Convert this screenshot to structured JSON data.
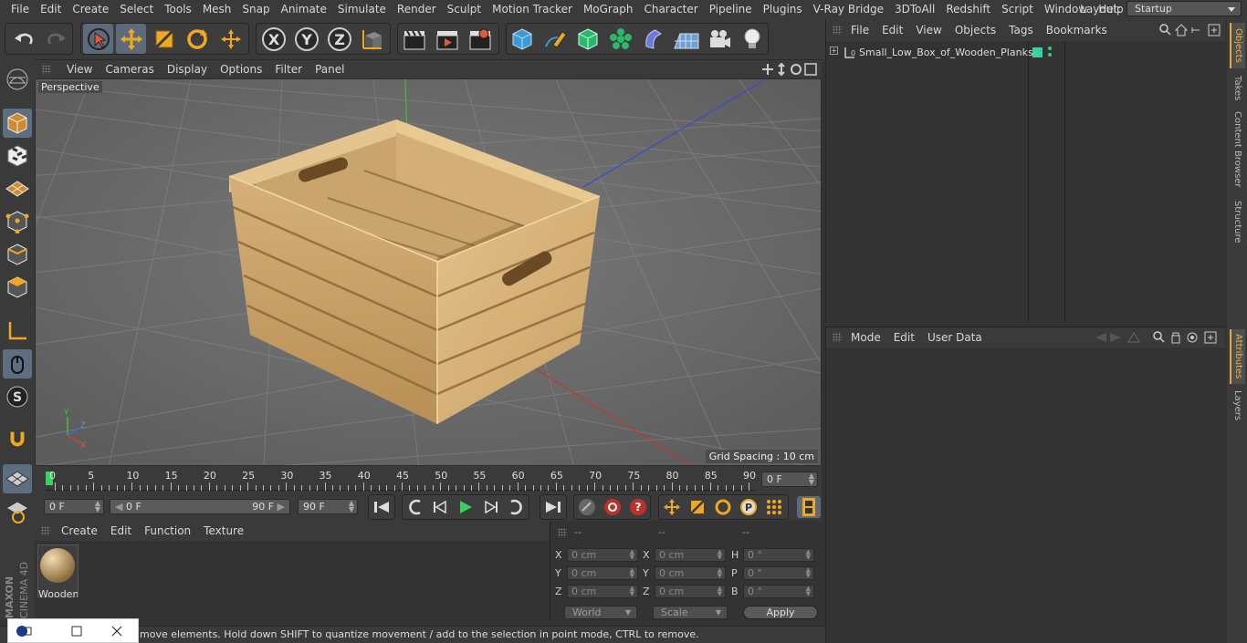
{
  "menubar": {
    "items": [
      "File",
      "Edit",
      "Create",
      "Select",
      "Tools",
      "Mesh",
      "Snap",
      "Animate",
      "Simulate",
      "Render",
      "Sculpt",
      "Motion Tracker",
      "MoGraph",
      "Character",
      "Pipeline",
      "Plugins",
      "V-Ray Bridge",
      "3DToAll",
      "Redshift",
      "Script",
      "Window",
      "Help"
    ],
    "layout_label": "Layout:",
    "layout_value": "Startup"
  },
  "viewport": {
    "menu": [
      "View",
      "Cameras",
      "Display",
      "Options",
      "Filter",
      "Panel"
    ],
    "label": "Perspective",
    "grid_spacing": "Grid Spacing : 10 cm",
    "axis_labels": {
      "y": "Y",
      "z": "Z",
      "x": "X"
    }
  },
  "timeline": {
    "ticks": [
      "0",
      "5",
      "10",
      "15",
      "20",
      "25",
      "30",
      "35",
      "40",
      "45",
      "50",
      "55",
      "60",
      "65",
      "70",
      "75",
      "80",
      "85",
      "90"
    ],
    "current_frame": "0 F"
  },
  "transport": {
    "start": "0 F",
    "range_start": "0 F",
    "range_end": "90 F",
    "end": "90 F"
  },
  "material_panel": {
    "menu": [
      "Create",
      "Edit",
      "Function",
      "Texture"
    ],
    "material_name": "Wooden"
  },
  "coord_panel": {
    "headers": [
      "--",
      "--",
      "--"
    ],
    "rows": [
      {
        "l1": "X",
        "v1": "0 cm",
        "l2": "X",
        "v2": "0 cm",
        "l3": "H",
        "v3": "0 °"
      },
      {
        "l1": "Y",
        "v1": "0 cm",
        "l2": "Y",
        "v2": "0 cm",
        "l3": "P",
        "v3": "0 °"
      },
      {
        "l1": "Z",
        "v1": "0 cm",
        "l2": "Z",
        "v2": "0 cm",
        "l3": "B",
        "v3": "0 °"
      }
    ],
    "world": "World",
    "scale": "Scale",
    "apply": "Apply"
  },
  "objects_panel": {
    "menu": [
      "File",
      "Edit",
      "View",
      "Objects",
      "Tags",
      "Bookmarks"
    ],
    "object_name": "Small_Low_Box_of_Wooden_Planks"
  },
  "attributes_panel": {
    "menu": [
      "Mode",
      "Edit",
      "User Data"
    ]
  },
  "right_tabs": [
    "Objects",
    "Takes",
    "Content Browser",
    "Structure",
    "Attributes",
    "Layers"
  ],
  "status": "move elements. Hold down SHIFT to quantize movement / add to the selection in point mode, CTRL to remove.",
  "brand": {
    "maxon": "MAXON",
    "product": "CINEMA 4D"
  },
  "colors": {
    "accent": "#e8a93a",
    "selected": "#5c6a79",
    "viewport_bg": "#6d6d6d",
    "crate": "#d8b57a"
  }
}
